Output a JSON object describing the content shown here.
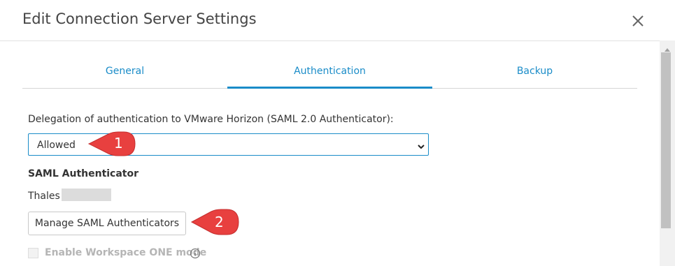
{
  "dialog": {
    "title": "Edit Connection Server Settings"
  },
  "tabs": [
    {
      "label": "General"
    },
    {
      "label": "Authentication"
    },
    {
      "label": "Backup"
    }
  ],
  "auth": {
    "delegation_label": "Delegation of authentication to VMware Horizon (SAML 2.0 Authenticator):",
    "delegation_value": "Allowed",
    "saml_heading": "SAML Authenticator",
    "saml_name": "Thales -",
    "manage_button": "Manage SAML Authenticators",
    "workspace_label": "Enable Workspace ONE mode"
  },
  "callouts": [
    {
      "number": "1"
    },
    {
      "number": "2"
    }
  ],
  "colors": {
    "accent": "#1a8cc8",
    "callout": "#e8403f"
  }
}
